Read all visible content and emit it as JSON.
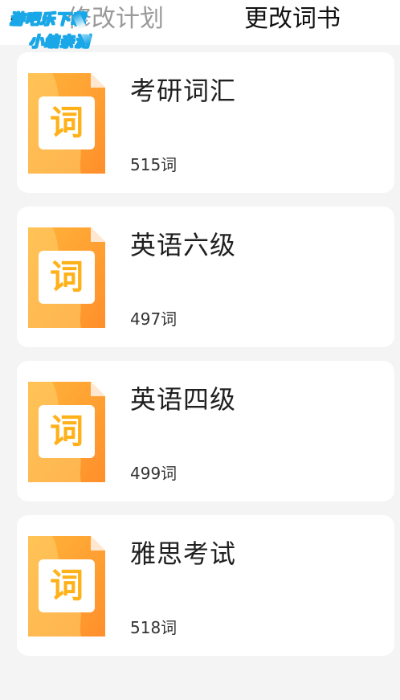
{
  "header": {
    "back_icon": "chevron-left-icon",
    "tab_plan": "修改计划",
    "tab_book": "更改词书"
  },
  "watermark": {
    "line1": "游吧乐下载",
    "line2": "小编亲测"
  },
  "books": [
    {
      "title": "考研词汇",
      "count": "515词",
      "cover_char": "词"
    },
    {
      "title": "英语六级",
      "count": "497词",
      "cover_char": "词"
    },
    {
      "title": "英语四级",
      "count": "499词",
      "cover_char": "词"
    },
    {
      "title": "雅思考试",
      "count": "518词",
      "cover_char": "词"
    }
  ],
  "colors": {
    "cover_orange": "#ff9a2e",
    "cover_light": "#ffcf64",
    "cover_text": "#ffb11a",
    "card_bg": "#ffffff",
    "page_bg": "#f4f4f4"
  }
}
